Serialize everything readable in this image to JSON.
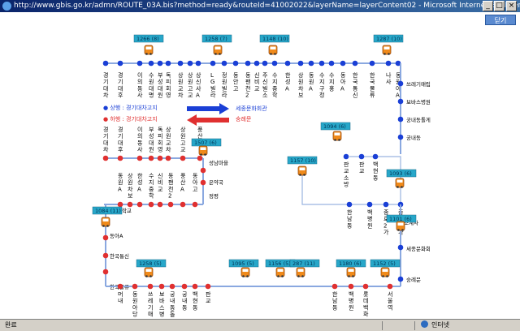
{
  "window": {
    "title": "http://www.gbis.go.kr/admn/ROUTE_03A.bis?method=ready&routeId=41002022&layerName=layerContent02 - Microsoft Internet Explorer",
    "close_label": "닫기"
  },
  "status": {
    "left": "완료",
    "zone": "인터넷"
  },
  "legend": {
    "up_label": "● 상행 : 경기대차고지",
    "up_dest": "세종문화회관",
    "down_label": "● 하행 : 경기대차고지",
    "down_dest": "숭례문"
  },
  "colors": {
    "up": "#1a3fd6",
    "down": "#e03030",
    "label_bg": "#27a7c9",
    "line": "#8aa8e0"
  },
  "stops": {
    "top_up": [
      "경기대차",
      "경기대후",
      "이의동사",
      "수원대명",
      "부성대원",
      "독피회영",
      "상원교차",
      "상원고교",
      "상신사A",
      "LG빌라",
      "정원빌라",
      "동안고",
      "동팬천2",
      "신비교",
      "주신빌소",
      "수지중학",
      "한성A",
      "상원차보",
      "동원A",
      "수지구청",
      "수지홍",
      "동아A",
      "한국통신",
      "한국물류",
      "나사",
      "동원아A"
    ],
    "right_up": [
      "쓰레기매립",
      "보바스병원",
      "궁내동톨게",
      "궁내동"
    ],
    "legend_row": [
      "경기대차",
      "경기대후",
      "이의동사",
      "부성대원",
      "독피회영",
      "상원교차",
      "상원고교",
      "풍산A"
    ],
    "mid_right": [
      "판교소방",
      "판교",
      "백현동"
    ],
    "mid_left": [
      "동원A",
      "상원차보",
      "한성A",
      "수지중학",
      "신비교",
      "동팬천2",
      "풍산A",
      "동아고"
    ],
    "mid_bottom": [
      "한남동",
      "백병원",
      "종로2가",
      "종로1가"
    ],
    "left_down": [
      "수지중학교",
      "동아A",
      "한국통신",
      "한국물류"
    ],
    "bottom_down": [
      "머내",
      "동원아당",
      "쓰레기매",
      "보바스병",
      "궁내동톨",
      "궁내동",
      "백현동",
      "판교",
      "한남동",
      "백병원",
      "롯데백화",
      "서울역"
    ],
    "named_points": {
      "seongnam": "성남마을",
      "eunyak": "은약국",
      "jeongpyeong": "정평",
      "jongno1": "종로1가",
      "jogyesa": "조계사",
      "sejong": "세종문화회",
      "sungnyemun": "숭례문"
    }
  },
  "buses": [
    {
      "label": "1266 (8)"
    },
    {
      "label": "1258 (7)"
    },
    {
      "label": "1148 (10)"
    },
    {
      "label": "1287 (10)"
    },
    {
      "label": "1507 (6)"
    },
    {
      "label": "1094 (6)"
    },
    {
      "label": "1157 (10)"
    },
    {
      "label": "1093 (6)"
    },
    {
      "label": "1084 (11)"
    },
    {
      "label": "1101 (6)"
    },
    {
      "label": "1258 (5)"
    },
    {
      "label": "1095 (5)"
    },
    {
      "label": "1156 (5)"
    },
    {
      "label": "287 (11)"
    },
    {
      "label": "1180 (6)"
    },
    {
      "label": "1152 (5)"
    }
  ]
}
